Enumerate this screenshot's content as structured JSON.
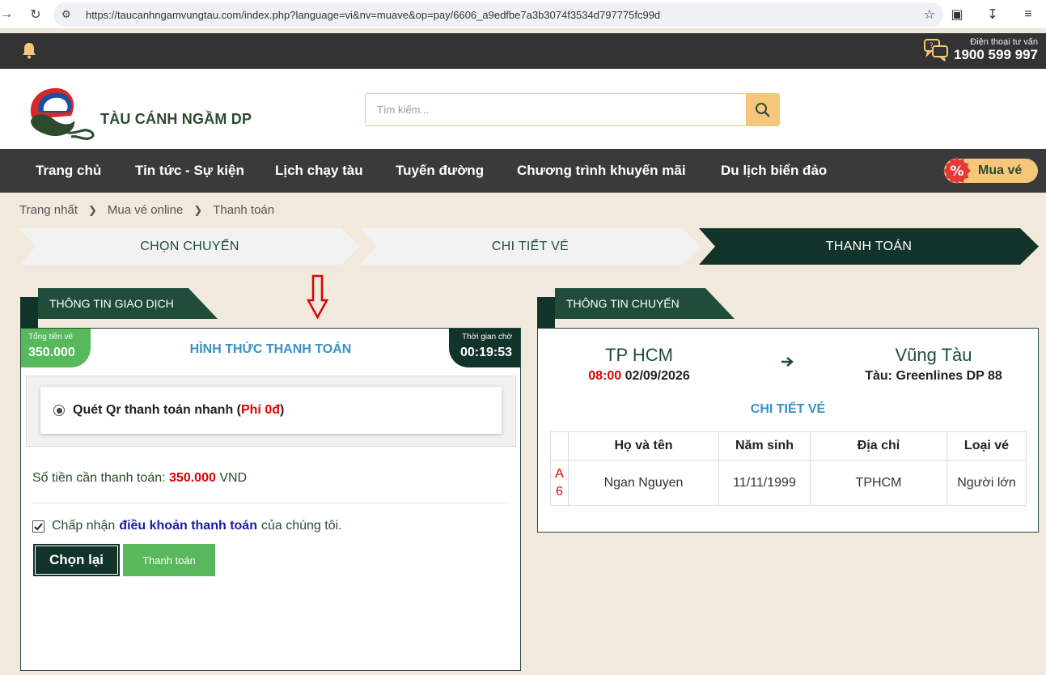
{
  "browser": {
    "url": "https://taucanhngamvungtau.com/index.php?language=vi&nv=muave&op=pay/6606_a9edfbe7a3b3074f3534d797775fc99d"
  },
  "topbar": {
    "hotline_label": "Điện thoại tư vấn",
    "hotline_number": "1900 599 997"
  },
  "header": {
    "logo_text": "TÀU CÁNH NGẦM DP",
    "search_placeholder": "Tìm kiếm..."
  },
  "nav": {
    "items": [
      "Trang chủ",
      "Tin tức - Sự kiện",
      "Lịch chạy tàu",
      "Tuyến đường",
      "Chương trình khuyến mãi",
      "Du lịch biển đảo"
    ],
    "buy_label": "Mua vé",
    "buy_badge": "%"
  },
  "breadcrumb": [
    "Trang nhất",
    "Mua vé online",
    "Thanh toán"
  ],
  "steps": [
    {
      "label": "CHỌN CHUYẾN",
      "active": false
    },
    {
      "label": "CHI TIẾT VÉ",
      "active": false
    },
    {
      "label": "THANH TOÁN",
      "active": true
    }
  ],
  "transaction": {
    "tab_label": "THÔNG TIN GIAO DỊCH",
    "total_label": "Tổng tiền vé",
    "total_value": "350.000",
    "title": "HÌNH THỨC THANH TOÁN",
    "wait_label": "Thời gian chờ",
    "wait_value": "00:19:53",
    "method_name": "Quét Qr thanh toán nhanh (",
    "method_fee": "Phí 0đ",
    "method_close": ")",
    "amount_label": "Số tiền cần thanh toán:",
    "amount_value": "350.000",
    "amount_unit": "VND",
    "terms_pre": "Chấp nhận",
    "terms_link": "điều khoản thanh toán",
    "terms_post": "của chúng tôi.",
    "reset_label": "Chọn lại",
    "pay_label": "Thanh toán"
  },
  "trip": {
    "tab_label": "THÔNG TIN CHUYẾN",
    "from": "TP HCM",
    "depart_time": "08:00",
    "depart_date": "02/09/2026",
    "to": "Vũng Tàu",
    "ship": "Tàu: Greenlines DP 88",
    "detail_title": "CHI TIẾT VÉ",
    "columns": [
      "",
      "Họ và tên",
      "Năm sinh",
      "Địa chỉ",
      "Loại vé"
    ],
    "rows": [
      {
        "seat_row": "A",
        "seat_num": "6",
        "name": "Ngan Nguyen",
        "dob": "11/11/1999",
        "address": "TPHCM",
        "type": "Người lớn"
      }
    ]
  },
  "colors": {
    "dark_green": "#12332a",
    "accent_green": "#58b85c",
    "gold": "#f6c67a",
    "blue_title": "#3a8fc8",
    "red": "#e00000"
  }
}
